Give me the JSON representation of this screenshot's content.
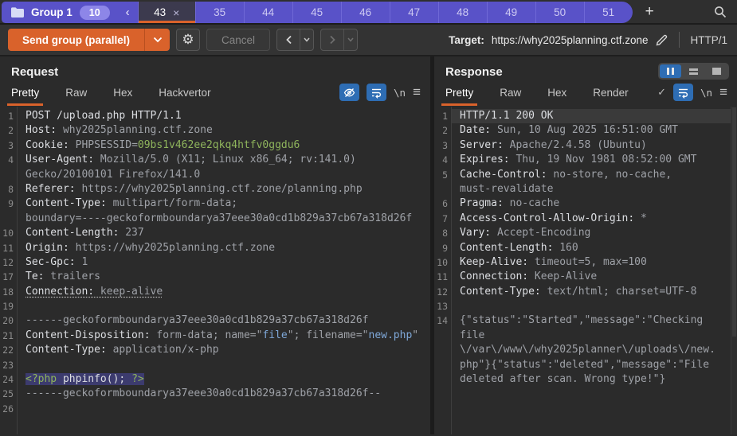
{
  "colors": {
    "accent_orange": "#d9622b",
    "group_purple": "#5952c8",
    "icon_blue": "#2e6db4",
    "selection_blue": "#3c3b6e",
    "syntax_green": "#8fb55c",
    "syntax_blue": "#7fa8d9"
  },
  "icons": {
    "gear": "⚙",
    "menu": "≡",
    "check": "✓",
    "close": "×",
    "add": "+",
    "collapse": "‹"
  },
  "tab_bar": {
    "group_label": "Group 1",
    "group_badge": "10",
    "active_tab": "43",
    "tabs": [
      "35",
      "44",
      "45",
      "46",
      "47",
      "48",
      "49",
      "50",
      "51"
    ]
  },
  "toolbar": {
    "send_label": "Send group (parallel)",
    "cancel_label": "Cancel",
    "target_label": "Target:",
    "target_url": "https://why2025planning.ctf.zone",
    "protocol": "HTTP/1"
  },
  "request": {
    "title": "Request",
    "tabs": [
      "Pretty",
      "Raw",
      "Hex",
      "Hackvertor"
    ],
    "active_tab": "Pretty",
    "newline_label": "\\n",
    "lines": [
      {
        "n": "1",
        "s": [
          [
            "POST /upload.php HTTP/1.1",
            "name"
          ]
        ]
      },
      {
        "n": "2",
        "s": [
          [
            "Host:",
            "name"
          ],
          [
            " why2025planning.ctf.zone",
            "val"
          ]
        ]
      },
      {
        "n": "3",
        "s": [
          [
            "Cookie:",
            "name"
          ],
          [
            " PHPSESSID=",
            "val"
          ],
          [
            "09bs1v462ee2qkq4htfv0ggdu6",
            "grn"
          ]
        ]
      },
      {
        "n": "4",
        "s": [
          [
            "User-Agent:",
            "name"
          ],
          [
            " Mozilla/5.0 (X11; Linux x86_64; rv:141.0)",
            "val"
          ]
        ]
      },
      {
        "n": "",
        "s": [
          [
            "Gecko/20100101 Firefox/141.0",
            "val"
          ]
        ]
      },
      {
        "n": "8",
        "s": [
          [
            "Referer:",
            "name"
          ],
          [
            " https://why2025planning.ctf.zone/planning.php",
            "val"
          ]
        ]
      },
      {
        "n": "9",
        "s": [
          [
            "Content-Type:",
            "name"
          ],
          [
            " multipart/form-data;",
            "val"
          ]
        ]
      },
      {
        "n": "",
        "s": [
          [
            "boundary=----geckoformboundarya37eee30a0cd1b829a37cb67a318d26f",
            "val"
          ]
        ]
      },
      {
        "n": "10",
        "s": [
          [
            "Content-Length:",
            "name"
          ],
          [
            " 237",
            "val"
          ]
        ]
      },
      {
        "n": "11",
        "s": [
          [
            "Origin:",
            "name"
          ],
          [
            " https://why2025planning.ctf.zone",
            "val"
          ]
        ]
      },
      {
        "n": "12",
        "s": [
          [
            "Sec-Gpc:",
            "name"
          ],
          [
            " 1",
            "val"
          ]
        ]
      },
      {
        "n": "17",
        "s": [
          [
            "Te:",
            "name"
          ],
          [
            " trailers",
            "val"
          ]
        ]
      },
      {
        "n": "18",
        "s": [
          [
            "Connection:",
            "name dot"
          ],
          [
            " keep-alive",
            "val dot"
          ]
        ]
      },
      {
        "n": "19",
        "s": []
      },
      {
        "n": "20",
        "s": [
          [
            "------geckoformboundarya37eee30a0cd1b829a37cb67a318d26f",
            "val"
          ]
        ]
      },
      {
        "n": "21",
        "s": [
          [
            "Content-Disposition:",
            "name"
          ],
          [
            " form-data; name=\"",
            "val"
          ],
          [
            "file",
            "blu"
          ],
          [
            "\"; filename=\"",
            "val"
          ],
          [
            "new.php",
            "blu"
          ],
          [
            "\"",
            "val"
          ]
        ]
      },
      {
        "n": "22",
        "s": [
          [
            "Content-Type:",
            "name"
          ],
          [
            " application/x-php",
            "val"
          ]
        ]
      },
      {
        "n": "23",
        "s": []
      },
      {
        "n": "24",
        "cls": "sel",
        "s": [
          [
            "<?php",
            "grn"
          ],
          [
            " phpinfo(); ",
            "name"
          ],
          [
            "?>",
            "grn"
          ]
        ]
      },
      {
        "n": "25",
        "s": [
          [
            "------geckoformboundarya37eee30a0cd1b829a37cb67a318d26f--",
            "val"
          ]
        ]
      },
      {
        "n": "26",
        "s": []
      }
    ]
  },
  "response": {
    "title": "Response",
    "tabs": [
      "Pretty",
      "Raw",
      "Hex",
      "Render"
    ],
    "active_tab": "Pretty",
    "newline_label": "\\n",
    "lines": [
      {
        "n": "1",
        "cls": "cur",
        "s": [
          [
            "HTTP/1.1 200 OK",
            "name"
          ]
        ]
      },
      {
        "n": "2",
        "s": [
          [
            "Date:",
            "name"
          ],
          [
            " Sun, 10 Aug 2025 16:51:00 GMT",
            "val"
          ]
        ]
      },
      {
        "n": "3",
        "s": [
          [
            "Server:",
            "name"
          ],
          [
            " Apache/2.4.58 (Ubuntu)",
            "val"
          ]
        ]
      },
      {
        "n": "4",
        "s": [
          [
            "Expires:",
            "name"
          ],
          [
            " Thu, 19 Nov 1981 08:52:00 GMT",
            "val"
          ]
        ]
      },
      {
        "n": "5",
        "s": [
          [
            "Cache-Control:",
            "name"
          ],
          [
            " no-store, no-cache,",
            "val"
          ]
        ]
      },
      {
        "n": "",
        "s": [
          [
            "must-revalidate",
            "val"
          ]
        ]
      },
      {
        "n": "6",
        "s": [
          [
            "Pragma:",
            "name"
          ],
          [
            " no-cache",
            "val"
          ]
        ]
      },
      {
        "n": "7",
        "s": [
          [
            "Access-Control-Allow-Origin:",
            "name"
          ],
          [
            " *",
            "val"
          ]
        ]
      },
      {
        "n": "8",
        "s": [
          [
            "Vary:",
            "name"
          ],
          [
            " Accept-Encoding",
            "val"
          ]
        ]
      },
      {
        "n": "9",
        "s": [
          [
            "Content-Length:",
            "name"
          ],
          [
            " 160",
            "val"
          ]
        ]
      },
      {
        "n": "10",
        "s": [
          [
            "Keep-Alive:",
            "name"
          ],
          [
            " timeout=5, max=100",
            "val"
          ]
        ]
      },
      {
        "n": "11",
        "s": [
          [
            "Connection:",
            "name"
          ],
          [
            " Keep-Alive",
            "val"
          ]
        ]
      },
      {
        "n": "12",
        "s": [
          [
            "Content-Type:",
            "name"
          ],
          [
            " text/html; charset=UTF-8",
            "val"
          ]
        ]
      },
      {
        "n": "13",
        "s": []
      },
      {
        "n": "14",
        "s": [
          [
            "{\"status\":\"Started\",\"message\":\"Checking",
            "val"
          ]
        ]
      },
      {
        "n": "",
        "s": [
          [
            "file",
            "val"
          ]
        ]
      },
      {
        "n": "",
        "s": [
          [
            "\\/var\\/www\\/why2025planner\\/uploads\\/new.",
            "val"
          ]
        ]
      },
      {
        "n": "",
        "s": [
          [
            "php\"}{\"status\":\"deleted\",\"message\":\"File",
            "val"
          ]
        ]
      },
      {
        "n": "",
        "s": [
          [
            "deleted after scan. Wrong type!\"}",
            "val"
          ]
        ]
      }
    ]
  }
}
